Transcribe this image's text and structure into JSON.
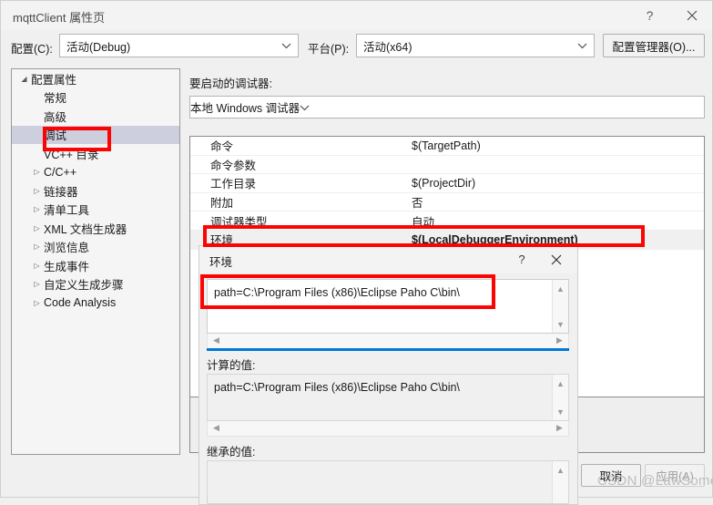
{
  "window": {
    "title": "mqttClient 属性页",
    "help_icon": "?",
    "close_icon": "×"
  },
  "config_bar": {
    "config_label": "配置(C):",
    "config_value": "活动(Debug)",
    "platform_label": "平台(P):",
    "platform_value": "活动(x64)",
    "config_manager_button": "配置管理器(O)...",
    "dropdown_icon": "⌄"
  },
  "tree": {
    "items": [
      {
        "label": "配置属性",
        "depth": 0,
        "glyph": "◢",
        "selected": false
      },
      {
        "label": "常规",
        "depth": 1,
        "glyph": "",
        "selected": false
      },
      {
        "label": "高级",
        "depth": 1,
        "glyph": "",
        "selected": false
      },
      {
        "label": "调试",
        "depth": 1,
        "glyph": "",
        "selected": true
      },
      {
        "label": "VC++ 目录",
        "depth": 1,
        "glyph": "",
        "selected": false
      },
      {
        "label": "C/C++",
        "depth": 1,
        "glyph": "▷",
        "selected": false
      },
      {
        "label": "链接器",
        "depth": 1,
        "glyph": "▷",
        "selected": false
      },
      {
        "label": "清单工具",
        "depth": 1,
        "glyph": "▷",
        "selected": false
      },
      {
        "label": "XML 文档生成器",
        "depth": 1,
        "glyph": "▷",
        "selected": false
      },
      {
        "label": "浏览信息",
        "depth": 1,
        "glyph": "▷",
        "selected": false
      },
      {
        "label": "生成事件",
        "depth": 1,
        "glyph": "▷",
        "selected": false
      },
      {
        "label": "自定义生成步骤",
        "depth": 1,
        "glyph": "▷",
        "selected": false
      },
      {
        "label": "Code Analysis",
        "depth": 1,
        "glyph": "▷",
        "selected": false
      }
    ]
  },
  "main": {
    "debugger_label": "要启动的调试器:",
    "debugger_value": "本地 Windows 调试器",
    "dropdown_icon": "⌄",
    "properties": [
      {
        "name": "命令",
        "value": "$(TargetPath)",
        "highlight": false
      },
      {
        "name": "命令参数",
        "value": "",
        "highlight": false
      },
      {
        "name": "工作目录",
        "value": "$(ProjectDir)",
        "highlight": false
      },
      {
        "name": "附加",
        "value": "否",
        "highlight": false
      },
      {
        "name": "调试器类型",
        "value": "自动",
        "highlight": false
      },
      {
        "name": "环境",
        "value": "$(LocalDebuggerEnvironment)",
        "highlight": true
      }
    ]
  },
  "footer": {
    "cancel_button": "取消",
    "apply_button": "应用(A)"
  },
  "env_dialog": {
    "title": "环境",
    "help_icon": "?",
    "close_icon": "×",
    "value_text": "path=C:\\Program Files (x86)\\Eclipse Paho C\\bin\\",
    "evaluated_label": "计算的值:",
    "evaluated_text": "path=C:\\Program Files (x86)\\Eclipse Paho C\\bin\\",
    "inherited_label": "继承的值:",
    "inherited_text": "",
    "scroll_up_icon": "▲",
    "scroll_down_icon": "▼",
    "scroll_left_icon": "◀",
    "scroll_right_icon": "▶"
  },
  "annotations": {
    "accent_red": "#fc0404",
    "focus_blue": "#0078d7",
    "selection_gray": "#cdcede"
  },
  "watermark": {
    "text": "CSDN @LawSome"
  }
}
